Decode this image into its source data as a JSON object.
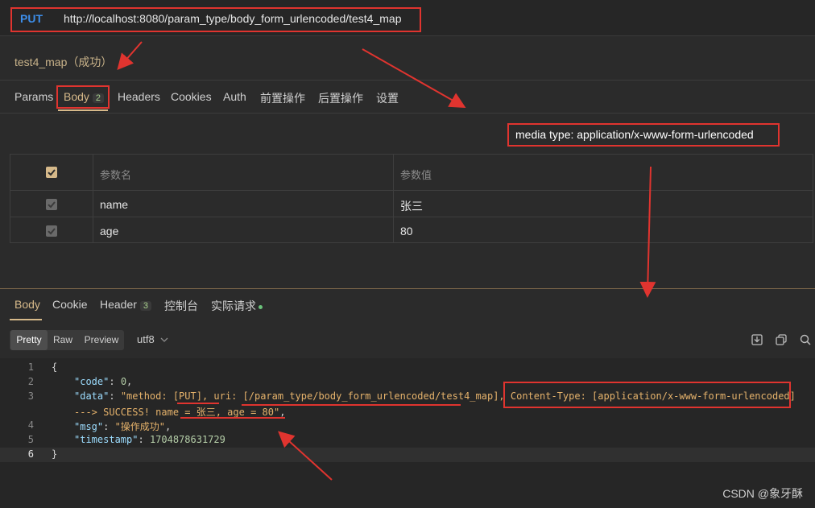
{
  "request": {
    "method": "PUT",
    "url": "http://localhost:8080/param_type/body_form_urlencoded/test4_map",
    "name": "test4_map（成功）"
  },
  "request_tabs": [
    {
      "label": "Params"
    },
    {
      "label": "Body",
      "badge": "2"
    },
    {
      "label": "Headers"
    },
    {
      "label": "Cookies"
    },
    {
      "label": "Auth"
    },
    {
      "label": "前置操作"
    },
    {
      "label": "后置操作"
    },
    {
      "label": "设置"
    }
  ],
  "media_type": "media type: application/x-www-form-urlencoded",
  "params": {
    "headers": [
      "参数名",
      "参数值"
    ],
    "rows": [
      {
        "name": "name",
        "value": "张三"
      },
      {
        "name": "age",
        "value": "80"
      }
    ]
  },
  "response_tabs": [
    {
      "label": "Body"
    },
    {
      "label": "Cookie"
    },
    {
      "label": "Header",
      "badge": "3"
    },
    {
      "label": "控制台"
    },
    {
      "label": "实际请求"
    }
  ],
  "view_modes": [
    "Pretty",
    "Raw",
    "Preview"
  ],
  "encoding": "utf8",
  "code": {
    "line_numbers": [
      "1",
      "2",
      "3",
      "",
      "4",
      "5",
      "6"
    ],
    "lines": {
      "l1": "{",
      "l2_key": "\"code\"",
      "l2_val": "0",
      "l3_key": "\"data\"",
      "l3_val_a": "\"method: [PUT], uri: [/param_type/body_form_urlencoded/test4_map], ",
      "l3_val_b": "Content-Type: [application/x-www-form-urlencoded]",
      "l3_cont": "---> SUCCESS! name = 张三, age = 80\"",
      "l4_key": "\"msg\"",
      "l4_val": "\"操作成功\"",
      "l5_key": "\"timestamp\"",
      "l5_val": "1704878631729",
      "l6": "}"
    }
  },
  "watermark": "CSDN @象牙酥",
  "colors": {
    "accent": "#d6b98a",
    "method": "#3d8eea",
    "annotation": "#e0342f"
  }
}
